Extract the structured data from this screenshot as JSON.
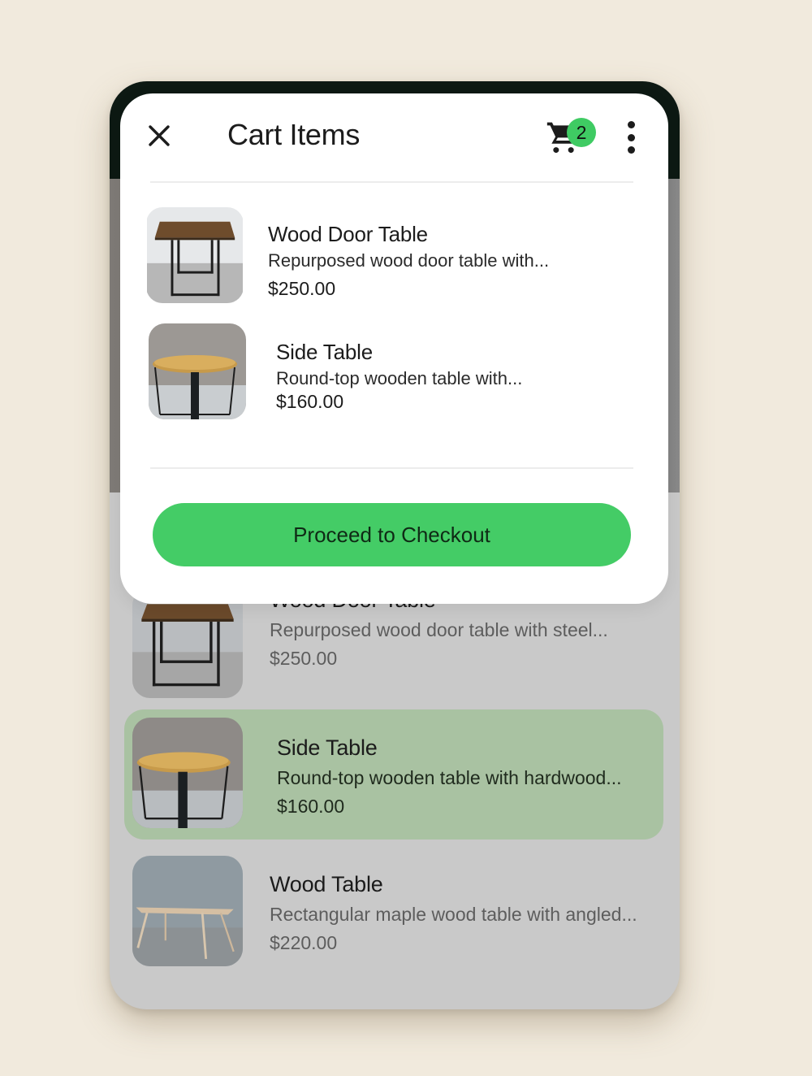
{
  "modal": {
    "title": "Cart Items",
    "cart_count": "2",
    "checkout_label": "Proceed to Checkout",
    "items": [
      {
        "title": "Wood Door Table",
        "description": "Repurposed wood door table with...",
        "price": "$250.00",
        "image": "wood-door-table"
      },
      {
        "title": "Side Table",
        "description": "Round-top wooden table with...",
        "price": "$160.00",
        "image": "side-table"
      }
    ]
  },
  "background_list": {
    "items": [
      {
        "title": "Wood Door Table",
        "description": "Repurposed wood door table with steel...",
        "price": "$250.00",
        "image": "wood-door-table",
        "selected": false
      },
      {
        "title": "Side Table",
        "description": "Round-top wooden table with hardwood...",
        "price": "$160.00",
        "image": "side-table",
        "selected": true
      },
      {
        "title": "Wood Table",
        "description": "Rectangular maple wood table with angled...",
        "price": "$220.00",
        "image": "maple-wood-table",
        "selected": false
      }
    ]
  },
  "colors": {
    "page_bg": "#f1eadd",
    "header_dark": "#0d1913",
    "accent_green": "#44cc66",
    "badge_green": "#3fcb63",
    "selected_row": "#a9c2a2",
    "scrim": "#c9c9c9"
  }
}
